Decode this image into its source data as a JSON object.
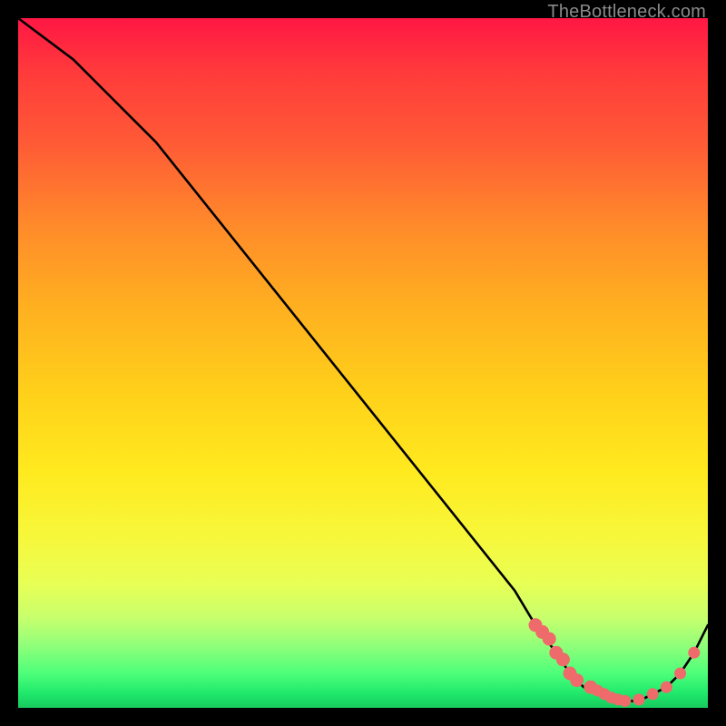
{
  "watermark": "TheBottleneck.com",
  "colors": {
    "line": "#000000",
    "marker": "#ef6a6a",
    "background_frame": "#000000"
  },
  "chart_data": {
    "type": "line",
    "title": "",
    "xlabel": "",
    "ylabel": "",
    "xlim": [
      0,
      100
    ],
    "ylim": [
      0,
      100
    ],
    "x": [
      0,
      4,
      8,
      12,
      16,
      20,
      24,
      28,
      32,
      36,
      40,
      44,
      48,
      52,
      56,
      60,
      64,
      68,
      72,
      75,
      78,
      80,
      82,
      84,
      86,
      88,
      90,
      92,
      94,
      96,
      98,
      100
    ],
    "values": [
      100,
      97,
      94,
      90,
      86,
      82,
      77,
      72,
      67,
      62,
      57,
      52,
      47,
      42,
      37,
      32,
      27,
      22,
      17,
      12,
      8,
      5,
      3,
      2,
      1,
      1,
      1,
      2,
      3,
      5,
      8,
      12
    ],
    "markers": {
      "x": [
        75,
        76,
        77,
        78,
        79,
        80,
        81,
        83,
        84,
        85,
        86,
        87,
        88,
        90,
        92,
        94,
        96,
        98
      ],
      "y": [
        12,
        11,
        10,
        8,
        7,
        5,
        4,
        3,
        2.5,
        2,
        1.5,
        1.2,
        1,
        1.2,
        2,
        3,
        5,
        8
      ]
    }
  }
}
